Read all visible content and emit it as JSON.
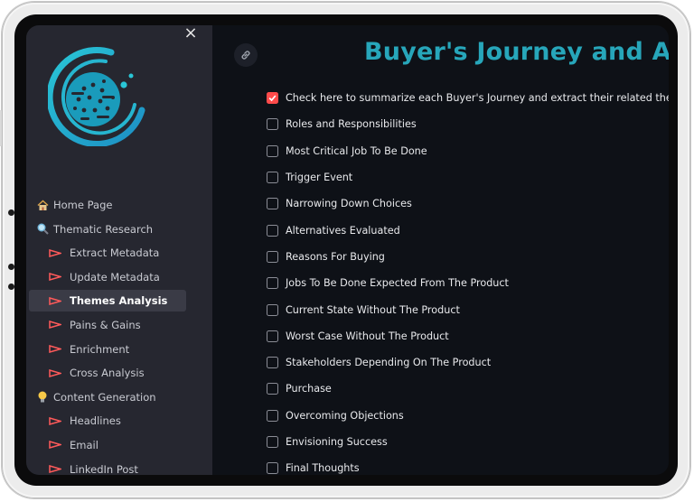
{
  "sidebar": {
    "close_label": "×",
    "items": [
      {
        "label": "Home Page",
        "icon": "house-icon",
        "level": "top"
      },
      {
        "label": "Thematic Research",
        "icon": "magnifier-icon",
        "level": "top"
      },
      {
        "label": "Extract Metadata",
        "icon": "triangle-flag-icon",
        "level": "sub"
      },
      {
        "label": "Update Metadata",
        "icon": "triangle-flag-icon",
        "level": "sub"
      },
      {
        "label": "Themes Analysis",
        "icon": "triangle-flag-icon",
        "level": "sub",
        "active": true
      },
      {
        "label": "Pains & Gains",
        "icon": "triangle-flag-icon",
        "level": "sub"
      },
      {
        "label": "Enrichment",
        "icon": "triangle-flag-icon",
        "level": "sub"
      },
      {
        "label": "Cross Analysis",
        "icon": "triangle-flag-icon",
        "level": "sub"
      },
      {
        "label": "Content Generation",
        "icon": "lightbulb-icon",
        "level": "top"
      },
      {
        "label": "Headlines",
        "icon": "triangle-flag-icon",
        "level": "sub"
      },
      {
        "label": "Email",
        "icon": "triangle-flag-icon",
        "level": "sub"
      },
      {
        "label": "LinkedIn Post",
        "icon": "triangle-flag-icon",
        "level": "sub"
      }
    ]
  },
  "main": {
    "title": "Buyer's Journey and Ass",
    "checkboxes": [
      {
        "label": "Check here to summarize each Buyer's Journey and extract their related themes from th",
        "checked": true
      },
      {
        "label": "Roles and Responsibilities",
        "checked": false
      },
      {
        "label": "Most Critical Job To Be Done",
        "checked": false
      },
      {
        "label": "Trigger Event",
        "checked": false
      },
      {
        "label": "Narrowing Down Choices",
        "checked": false
      },
      {
        "label": "Alternatives Evaluated",
        "checked": false
      },
      {
        "label": "Reasons For Buying",
        "checked": false
      },
      {
        "label": "Jobs To Be Done Expected From The Product",
        "checked": false
      },
      {
        "label": "Current State Without The Product",
        "checked": false
      },
      {
        "label": "Worst Case Without The Product",
        "checked": false
      },
      {
        "label": "Stakeholders Depending On The Product",
        "checked": false
      },
      {
        "label": "Purchase",
        "checked": false
      },
      {
        "label": "Overcoming Objections",
        "checked": false
      },
      {
        "label": "Envisioning Success",
        "checked": false
      },
      {
        "label": "Final Thoughts",
        "checked": false
      }
    ]
  },
  "colors": {
    "accent_title": "#27a6ba",
    "checkbox_checked": "#ff4b4b",
    "sidebar_bg": "#262730",
    "main_bg": "#0e1117"
  }
}
